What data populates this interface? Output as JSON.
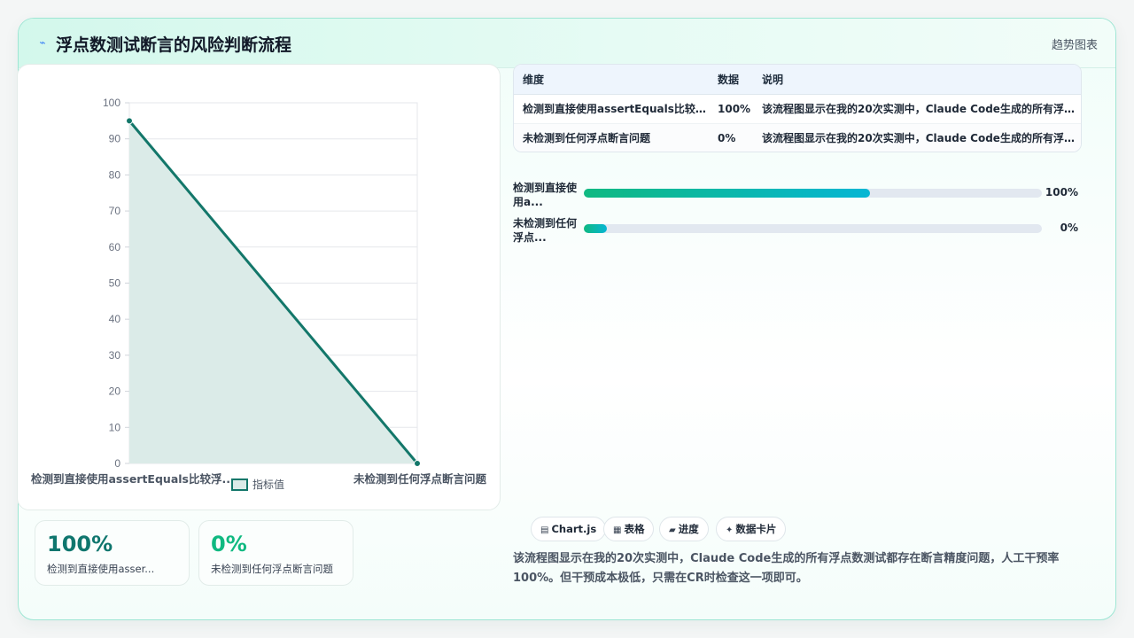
{
  "header": {
    "title": "浮点数测试断言的风险判断流程",
    "title_icon": "lightning-icon",
    "link": "趋势图表"
  },
  "chart_data": {
    "type": "area",
    "categories": [
      "检测到直接使用assertEquals比较浮...",
      "未检测到任何浮点断言问题"
    ],
    "series": [
      {
        "name": "指标值",
        "values": [
          95,
          0
        ],
        "color": "#13776a",
        "fill": "#dbebe8"
      }
    ],
    "ylim": [
      0,
      100
    ],
    "yticks": [
      "0",
      "10",
      "20",
      "30",
      "40",
      "50",
      "60",
      "70",
      "80",
      "90",
      "100"
    ],
    "grid": true,
    "legend": "bottom"
  },
  "kpis": [
    {
      "value": "100%",
      "label": "检测到直接使用asser...",
      "color": "#0f766e"
    },
    {
      "value": "0%",
      "label": "未检测到任何浮点断言问题",
      "color": "#10b981"
    }
  ],
  "table": {
    "headers": [
      "维度",
      "数据",
      "说明"
    ],
    "rows": [
      [
        "检测到直接使用assertEquals比较浮...",
        "100%",
        "该流程图显示在我的20次实测中，Claude Code生成的所有浮点..."
      ],
      [
        "未检测到任何浮点断言问题",
        "0%",
        "该流程图显示在我的20次实测中，Claude Code生成的所有浮点..."
      ]
    ]
  },
  "progress": [
    {
      "label": "检测到直接使用a...",
      "value_text": "100%",
      "fraction": 0.625
    },
    {
      "label": "未检测到任何浮点...",
      "value_text": "0%",
      "fraction": 0.05
    }
  ],
  "tags": [
    {
      "icon": "chart-icon",
      "glyph": "▤",
      "label": "Chart.js"
    },
    {
      "icon": "table-icon",
      "glyph": "▦",
      "label": "表格"
    },
    {
      "icon": "progress-icon",
      "glyph": "▰",
      "label": "进度"
    },
    {
      "icon": "sparkle-icon",
      "glyph": "✦",
      "label": "数据卡片"
    }
  ],
  "description": "该流程图显示在我的20次实测中，Claude Code生成的所有浮点数测试都存在断言精度问题，人工干预率100%。但干预成本极低，只需在CR时检查这一项即可。"
}
